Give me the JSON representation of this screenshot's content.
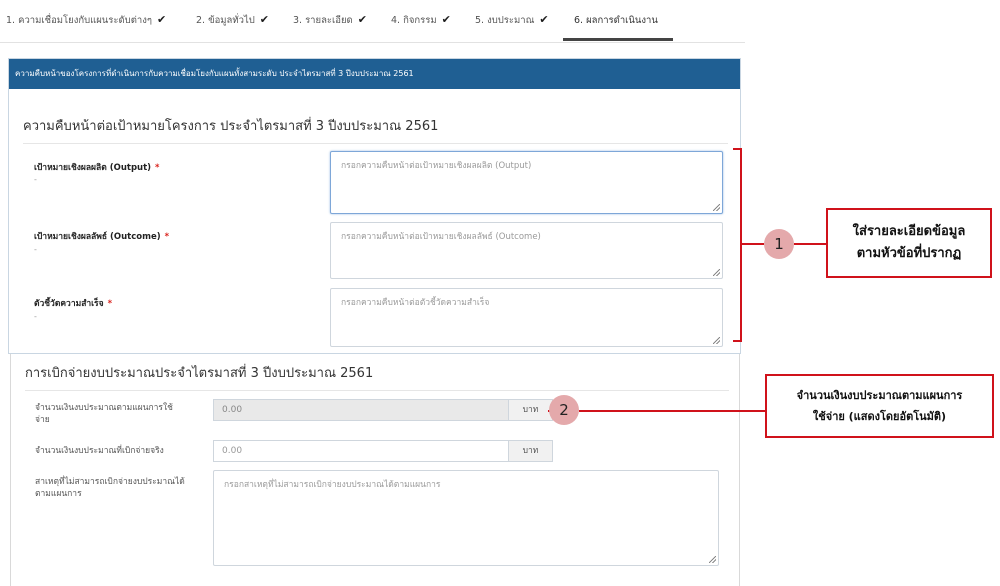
{
  "steps": [
    {
      "label": "1. ความเชื่อมโยงกับแผนระดับต่างๆ",
      "done": true
    },
    {
      "label": "2. ข้อมูลทั่วไป",
      "done": true
    },
    {
      "label": "3. รายละเอียด",
      "done": true
    },
    {
      "label": "4. กิจกรรม",
      "done": true
    },
    {
      "label": "5. งบประมาณ",
      "done": true
    },
    {
      "label": "6. ผลการดำเนินงาน",
      "done": false,
      "active": true
    }
  ],
  "check_glyph": "✔",
  "progress_panel": {
    "header": "ความคืบหน้าของโครงการที่ดำเนินการกับความเชื่อมโยงกับแผนทั้งสามระดับ ประจำไตรมาสที่ 3 ปีงบประมาณ 2561",
    "title": "ความคืบหน้าต่อเป้าหมายโครงการ ประจำไตรมาสที่ 3 ปีงบประมาณ 2561",
    "fields": [
      {
        "label": "เป้าหมายเชิงผลผลิต (Output)",
        "required_mark": "*",
        "sub": "-",
        "placeholder": "กรอกความคืบหน้าต่อเป้าหมายเชิงผลผลิต (Output)"
      },
      {
        "label": "เป้าหมายเชิงผลลัพธ์ (Outcome)",
        "required_mark": "*",
        "sub": "-",
        "placeholder": "กรอกความคืบหน้าต่อเป้าหมายเชิงผลลัพธ์ (Outcome)"
      },
      {
        "label": "ตัวชี้วัดความสำเร็จ",
        "required_mark": "*",
        "sub": "-",
        "placeholder": "กรอกความคืบหน้าต่อตัวชี้วัดความสำเร็จ"
      }
    ]
  },
  "budget_panel": {
    "title": "การเบิกจ่ายงบประมาณประจำไตรมาสที่ 3 ปีงบประมาณ 2561",
    "planned_label": "จำนวนเงินงบประมาณตามแผนการใช้จ่าย",
    "planned_value": "0.00",
    "planned_unit": "บาท",
    "actual_label": "จำนวนเงินงบประมาณที่เบิกจ่ายจริง",
    "actual_value": "0.00",
    "actual_unit": "บาท",
    "reason_label": "สาเหตุที่ไม่สามารถเบิกจ่ายงบประมาณได้ตามแผนการ",
    "reason_placeholder": "กรอกสาเหตุที่ไม่สามารถเบิกจ่ายงบประมาณได้ตามแผนการ"
  },
  "annotations": {
    "marker1": "1",
    "marker2": "2",
    "callout1_line1": "ใส่รายละเอียดข้อมูล",
    "callout1_line2": "ตามหัวข้อที่ปรากฏ",
    "callout2_line1": "จำนวนเงินงบประมาณตามแผนการ",
    "callout2_line2": "ใช้จ่าย (แสดงโดยอัตโนมัติ)"
  },
  "colors": {
    "panel_header": "#1f5f93",
    "required": "#d9231d",
    "annotation": "#d0121b",
    "marker": "#e4a9ab"
  }
}
